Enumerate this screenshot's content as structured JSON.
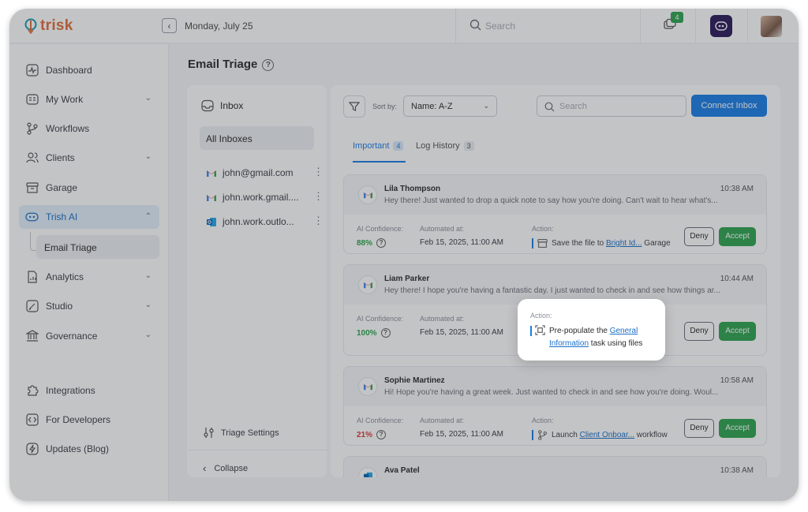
{
  "app": {
    "logo_text": "trisk",
    "date": "Monday, July 25",
    "search_placeholder": "Search",
    "notification_count": "4"
  },
  "colors": {
    "accent": "#1b7ee6",
    "brand": "#e16f3d",
    "success": "#2ea44f",
    "danger": "#d93a3a"
  },
  "sidebar": {
    "items": [
      {
        "label": "Dashboard",
        "icon": "pulse-icon"
      },
      {
        "label": "My Work",
        "icon": "id-card-icon"
      },
      {
        "label": "Workflows",
        "icon": "branch-icon"
      },
      {
        "label": "Clients",
        "icon": "users-icon"
      },
      {
        "label": "Garage",
        "icon": "archive-icon"
      },
      {
        "label": "Trish AI",
        "icon": "bot-icon"
      },
      {
        "label": "Analytics",
        "icon": "report-icon"
      },
      {
        "label": "Studio",
        "icon": "pen-icon"
      },
      {
        "label": "Governance",
        "icon": "bank-icon"
      },
      {
        "label": "Integrations",
        "icon": "puzzle-icon"
      },
      {
        "label": "For Developers",
        "icon": "code-icon"
      },
      {
        "label": "Updates (Blog)",
        "icon": "bolt-icon"
      }
    ],
    "sub_item": "Email Triage"
  },
  "page": {
    "title": "Email Triage"
  },
  "inbox_panel": {
    "title": "Inbox",
    "all_inboxes": "All Inboxes",
    "accounts": [
      {
        "label": "john@gmail.com",
        "type": "gmail"
      },
      {
        "label": "john.work.gmail....",
        "type": "gmail"
      },
      {
        "label": "john.work.outlo...",
        "type": "outlook"
      }
    ],
    "triage_settings": "Triage Settings",
    "collapse": "Collapse"
  },
  "toolbar": {
    "sort_by_label": "Sort by:",
    "sort_value": "Name: A-Z",
    "search_placeholder": "Search",
    "connect_label": "Connect Inbox"
  },
  "tabs": [
    {
      "label": "Important",
      "count": "4"
    },
    {
      "label": "Log History",
      "count": "3"
    }
  ],
  "labels": {
    "confidence": "AI Confidence:",
    "automated": "Automated at:",
    "action": "Action:",
    "deny": "Deny",
    "accept": "Accept"
  },
  "emails": [
    {
      "sender": "Lila Thompson",
      "time": "10:38 AM",
      "preview": "Hey there! Just wanted to drop a quick note to say how you're doing. Can't wait to hear what's...",
      "confidence": "88%",
      "confidence_level": "high",
      "automated_at": "Feb 15, 2025, 11:00 AM",
      "action_prefix": "Save the file to ",
      "action_link": "Bright Id...",
      "action_suffix": " Garage",
      "action_icon": "archive-icon"
    },
    {
      "sender": "Liam Parker",
      "time": "10:44 AM",
      "preview": "Hey there! I hope you're having a fantastic day. I just wanted to check in and see how things ar...",
      "confidence": "100%",
      "confidence_level": "high",
      "automated_at": "Feb 15, 2025, 11:00 AM",
      "action_prefix": "",
      "action_link": "",
      "action_suffix": "",
      "action_icon": "scan-icon"
    },
    {
      "sender": "Sophie Martinez",
      "time": "10:58 AM",
      "preview": "Hi! Hope you're having a great week. Just wanted to check in and see how you're doing. Woul...",
      "confidence": "21%",
      "confidence_level": "low",
      "automated_at": "Feb 15, 2025, 11:00 AM",
      "action_prefix": "Launch ",
      "action_link": "Client Onboar...",
      "action_suffix": " workflow",
      "action_icon": "branch-icon"
    },
    {
      "sender": "Ava Patel",
      "time": "10:38 AM",
      "preview": "",
      "confidence": "",
      "confidence_level": "",
      "automated_at": "",
      "action_prefix": "",
      "action_link": "",
      "action_suffix": "",
      "action_icon": ""
    }
  ],
  "popover": {
    "label": "Action:",
    "prefix": "Pre-populate the ",
    "link": "General Information",
    "suffix": " task using files",
    "icon": "scan-icon"
  }
}
